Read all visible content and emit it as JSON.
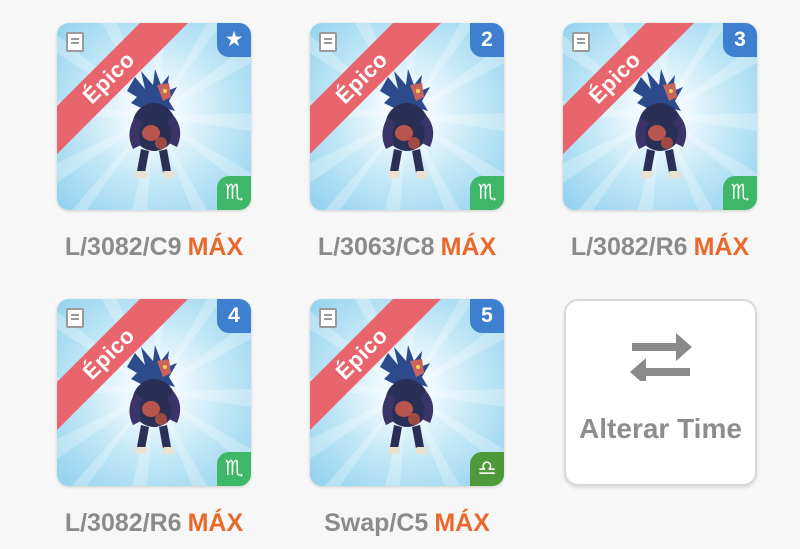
{
  "cards": [
    {
      "rarity": "Épico",
      "slot": "★",
      "element_icon": "scorpio-icon",
      "element_symbol": "♏",
      "element_color": "#3fb769",
      "label": "L/3082/C9",
      "max": "MÁX"
    },
    {
      "rarity": "Épico",
      "slot": "2",
      "element_icon": "scorpio-icon",
      "element_symbol": "♏",
      "element_color": "#3fb769",
      "label": "L/3063/C8",
      "max": "MÁX"
    },
    {
      "rarity": "Épico",
      "slot": "3",
      "element_icon": "scorpio-icon",
      "element_symbol": "♏",
      "element_color": "#3fb769",
      "label": "L/3082/R6",
      "max": "MÁX"
    },
    {
      "rarity": "Épico",
      "slot": "4",
      "element_icon": "scorpio-icon",
      "element_symbol": "♏",
      "element_color": "#3fb769",
      "label": "L/3082/R6",
      "max": "MÁX"
    },
    {
      "rarity": "Épico",
      "slot": "5",
      "element_icon": "libra-icon",
      "element_symbol": "♎",
      "element_color": "#4e9a3a",
      "label": "Swap/C5",
      "max": "MÁX"
    }
  ],
  "swap_button": {
    "label": "Alterar Time",
    "icon": "swap-arrows-icon"
  },
  "colors": {
    "ribbon": "#e8656d",
    "slot_badge": "#3f7fcf",
    "max_text": "#e8692c",
    "label_text": "#8b8b8b"
  }
}
